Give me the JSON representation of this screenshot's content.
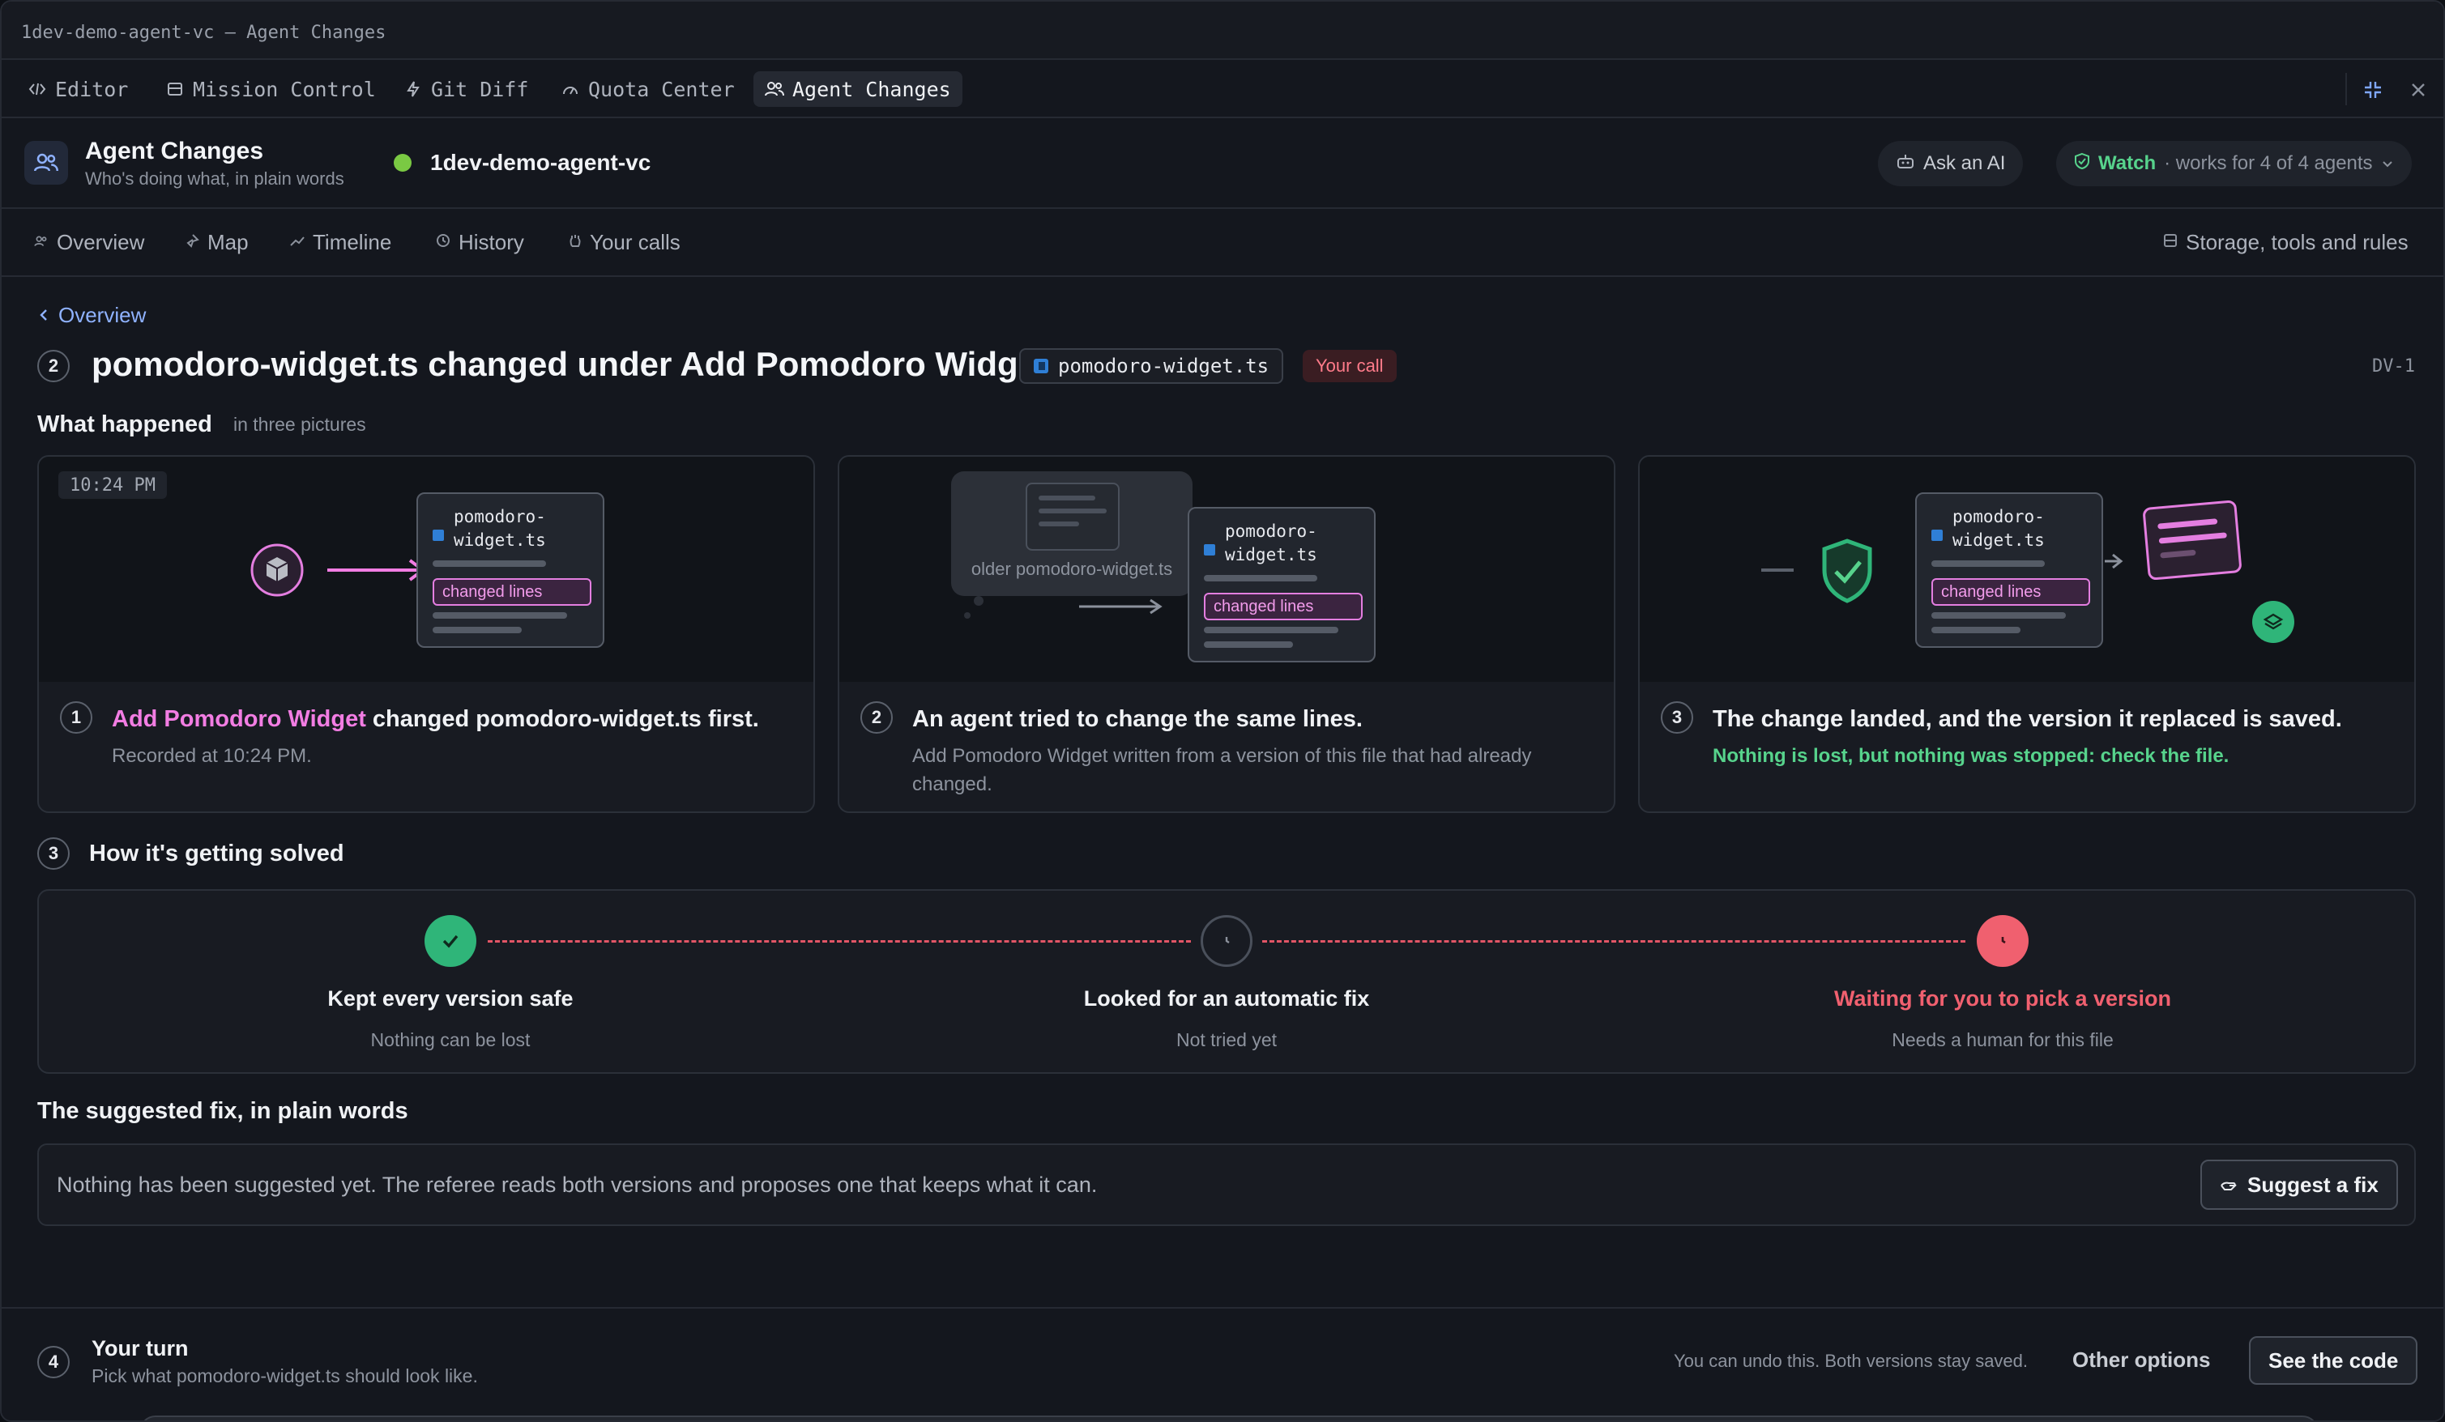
{
  "window": {
    "title": "1dev-demo-agent-vc — Agent Changes"
  },
  "tabs": [
    {
      "label": "Editor",
      "icon": "code-icon"
    },
    {
      "label": "Mission Control",
      "icon": "layout-icon"
    },
    {
      "label": "Git Diff",
      "icon": "bolt-icon"
    },
    {
      "label": "Quota Center",
      "icon": "gauge-icon"
    },
    {
      "label": "Agent Changes",
      "icon": "users-icon",
      "active": true
    }
  ],
  "header": {
    "title": "Agent Changes",
    "subtitle": "Who's doing what, in plain words",
    "project": "1dev-demo-agent-vc",
    "ask_label": "Ask an AI",
    "watch_label": "Watch",
    "watch_rest": "· works for 4 of 4 agents"
  },
  "subnav": {
    "items": [
      "Overview",
      "Map",
      "Timeline",
      "History",
      "Your calls"
    ],
    "right": "Storage, tools and rules"
  },
  "detail": {
    "back": "Overview",
    "step_num": "2",
    "title": "pomodoro-widget.ts changed under Add Pomodoro Widget",
    "file": "pomodoro-widget.ts",
    "badge": "Your call",
    "id": "DV-1"
  },
  "what_happened": {
    "title": "What happened",
    "sub": "in three pictures",
    "cards": [
      {
        "num": "1",
        "title_hl": "Add Pomodoro Widget",
        "title_rest": " changed pomodoro-widget.ts first.",
        "desc": "Recorded at 10:24 PM.",
        "time": "10:24 PM",
        "file_line1": "pomodoro-",
        "file_line2": "widget.ts",
        "changed": "changed lines"
      },
      {
        "num": "2",
        "title": "An agent tried to change the same lines.",
        "desc": "Add Pomodoro Widget written from a version of this file that had already changed.",
        "older": "older pomodoro-widget.ts",
        "file_line1": "pomodoro-",
        "file_line2": "widget.ts",
        "changed": "changed lines"
      },
      {
        "num": "3",
        "title": "The change landed, and the version it replaced is saved.",
        "desc": "Nothing is lost, but nothing was stopped: check the file.",
        "file_line1": "pomodoro-",
        "file_line2": "widget.ts",
        "changed": "changed lines"
      }
    ]
  },
  "solving": {
    "num": "3",
    "title": "How it's getting solved",
    "steps": [
      {
        "label": "Kept every version safe",
        "sub": "Nothing can be lost",
        "state": "done"
      },
      {
        "label": "Looked for an automatic fix",
        "sub": "Not tried yet",
        "state": "pending"
      },
      {
        "label": "Waiting for you to pick a version",
        "sub": "Needs a human for this file",
        "state": "waiting"
      }
    ]
  },
  "suggestion": {
    "title": "The suggested fix, in plain words",
    "text": "Nothing has been suggested yet. The referee reads both versions and proposes one that keeps what it can.",
    "button": "Suggest a fix"
  },
  "footer": {
    "num": "4",
    "title": "Your turn",
    "sub": "Pick what pomodoro-widget.ts should look like.",
    "note": "You can undo this. Both versions stay saved.",
    "other": "Other options",
    "primary": "See the code"
  },
  "colors": {
    "accent_green": "#57d38c",
    "accent_pink": "#f27de3",
    "alert_red": "#f0606f",
    "link_blue": "#8fb2ff"
  }
}
